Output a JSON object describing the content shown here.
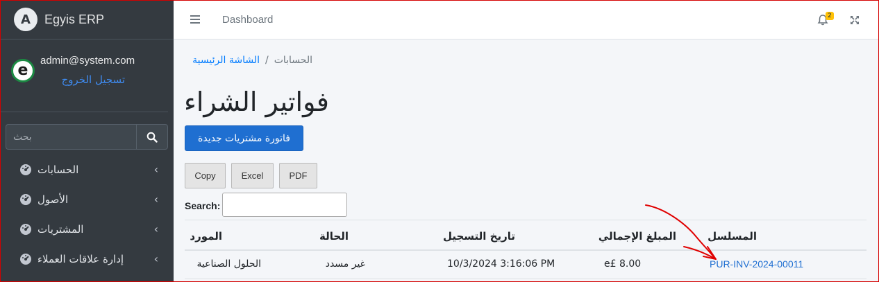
{
  "app": {
    "brand": "Egyis ERP",
    "logo_letter": "A"
  },
  "user": {
    "email": "admin@system.com",
    "logout": "تسجيل الخروج",
    "avatar_letter": "e"
  },
  "sidebar": {
    "search_placeholder": "بحث",
    "items": [
      {
        "label": "الحسابات",
        "icon": "gauge-icon"
      },
      {
        "label": "الأصول",
        "icon": "gauge-icon"
      },
      {
        "label": "المشتريات",
        "icon": "gauge-icon"
      },
      {
        "label": "إدارة علاقات العملاء",
        "icon": "gauge-icon"
      }
    ]
  },
  "topbar": {
    "dashboard": "Dashboard",
    "notifications_count": "2"
  },
  "breadcrumb": {
    "home": "الشاشة الرئيسية",
    "separator": "/",
    "current": "الحسابات"
  },
  "page": {
    "title": "فواتير الشراء",
    "new_button": "فاتورة مشتريات جديدة",
    "export_buttons": [
      "Copy",
      "Excel",
      "PDF"
    ],
    "search_label": "Search:"
  },
  "table": {
    "headers": {
      "supplier": "المورد",
      "status": "الحالة",
      "date": "تاريخ التسجيل",
      "total": "المبلغ الإجمالي",
      "serial": "المسلسل"
    },
    "rows": [
      {
        "supplier": "الحلول الصناعية",
        "status": "غير مسدد",
        "date": "10/3/2024 3:16:06 PM",
        "total": "e£ 8.00",
        "serial": "PUR-INV-2024-00011"
      }
    ]
  },
  "colors": {
    "sidebar": "#343a40",
    "primary": "#1f6fd1",
    "annotation": "#e00000"
  }
}
